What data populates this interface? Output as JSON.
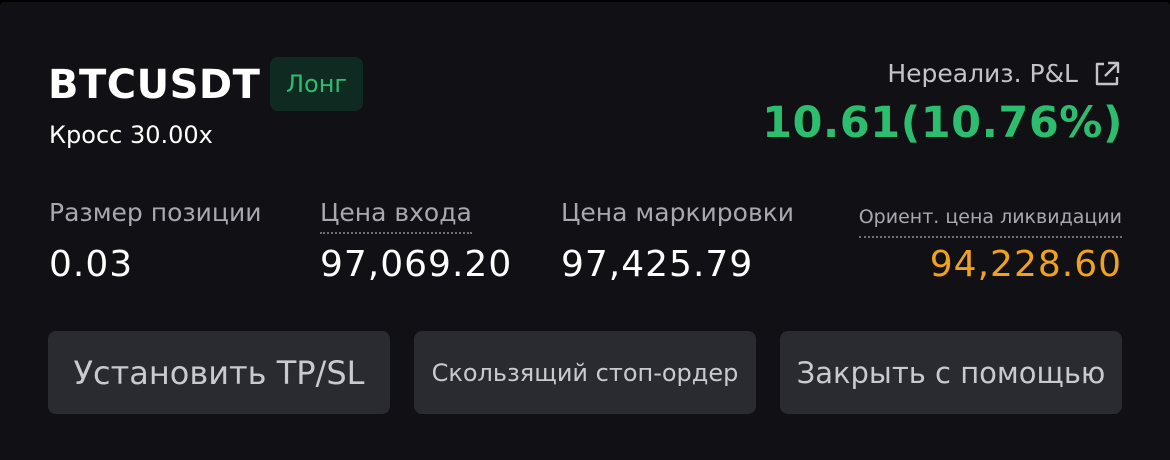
{
  "position": {
    "symbol": "BTCUSDT",
    "side": "Лонг",
    "margin_mode": "Кросс 30.00x"
  },
  "pnl": {
    "label": "Нереализ. P&L",
    "value": "10.61(10.76%)",
    "share_icon": "share-icon"
  },
  "stats": {
    "size_label": "Размер позиции",
    "size_value": "0.03",
    "entry_label": "Цена входа",
    "entry_value": "97,069.20",
    "mark_label": "Цена маркировки",
    "mark_value": "97,425.79",
    "liq_label": "Ориент. цена ликвидации",
    "liq_value": "94,228.60"
  },
  "actions": {
    "tpsl_label": "Установить TP/SL",
    "trailing_label": "Скользящий стоп-ордер",
    "close_label": "Закрыть с помощью"
  },
  "colors": {
    "profit": "#2dbd6e",
    "liquidation": "#f0a21c",
    "background": "#111115",
    "button_bg": "#2a2b30"
  }
}
